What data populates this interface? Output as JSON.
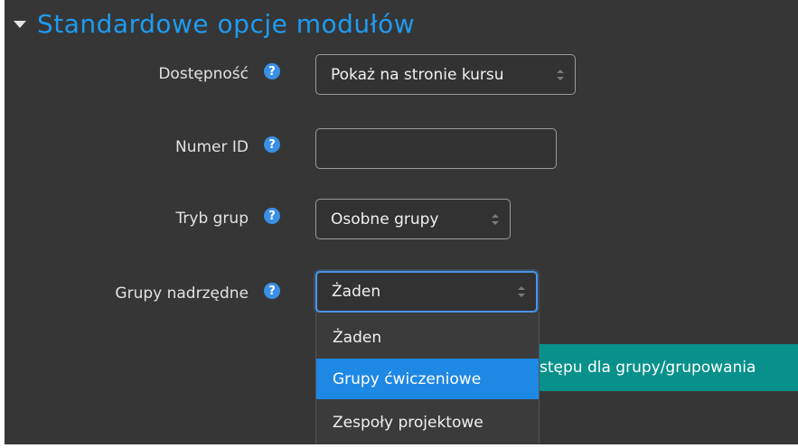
{
  "section": {
    "title": "Standardowe opcje modułów"
  },
  "fields": {
    "availability": {
      "label": "Dostępność",
      "value": "Pokaż na stronie kursu"
    },
    "idnumber": {
      "label": "Numer ID",
      "value": ""
    },
    "groupmode": {
      "label": "Tryb grup",
      "value": "Osobne grupy"
    },
    "grouping": {
      "label": "Grupy nadrzędne",
      "value": "Żaden",
      "options": [
        "Żaden",
        "Grupy ćwiczeniowe",
        "Zespoły projektowe"
      ],
      "highlighted_option": "Grupy ćwiczeniowe"
    }
  },
  "help_icon_glyph": "?",
  "restriction_button_partial": "stępu dla grupy/grupowania",
  "colors": {
    "accent": "#1e9bf0",
    "panel_bg": "#363636",
    "teal": "#08918b",
    "highlight": "#1e88e5"
  }
}
